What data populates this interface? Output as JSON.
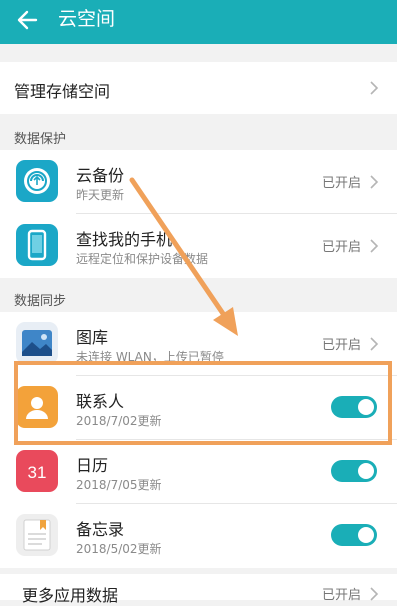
{
  "header": {
    "title": "云空间",
    "back_icon": "arrow-left-icon"
  },
  "manage": {
    "label": "管理存储空间"
  },
  "sections": {
    "protection": "数据保护",
    "sync": "数据同步"
  },
  "protection_items": [
    {
      "title": "云备份",
      "subtitle": "昨天更新",
      "status": "已开启",
      "icon": "cloud-backup-icon"
    },
    {
      "title": "查找我的手机",
      "subtitle": "远程定位和保护设备数据",
      "status": "已开启",
      "icon": "find-phone-icon"
    }
  ],
  "sync_items": [
    {
      "title": "图库",
      "subtitle": "未连接 WLAN，上传已暂停",
      "status": "已开启",
      "icon": "gallery-icon"
    },
    {
      "title": "联系人",
      "subtitle": "2018/7/02更新",
      "toggle_on": true,
      "icon": "contacts-icon"
    },
    {
      "title": "日历",
      "subtitle": "2018/7/05更新",
      "toggle_on": true,
      "icon": "calendar-icon",
      "calendar_day": "31"
    },
    {
      "title": "备忘录",
      "subtitle": "2018/5/02更新",
      "toggle_on": true,
      "icon": "notes-icon"
    }
  ],
  "more": {
    "label": "更多应用数据",
    "status": "已开启"
  },
  "colors": {
    "accent": "#1aaeb7",
    "highlight": "#f0a15a"
  }
}
